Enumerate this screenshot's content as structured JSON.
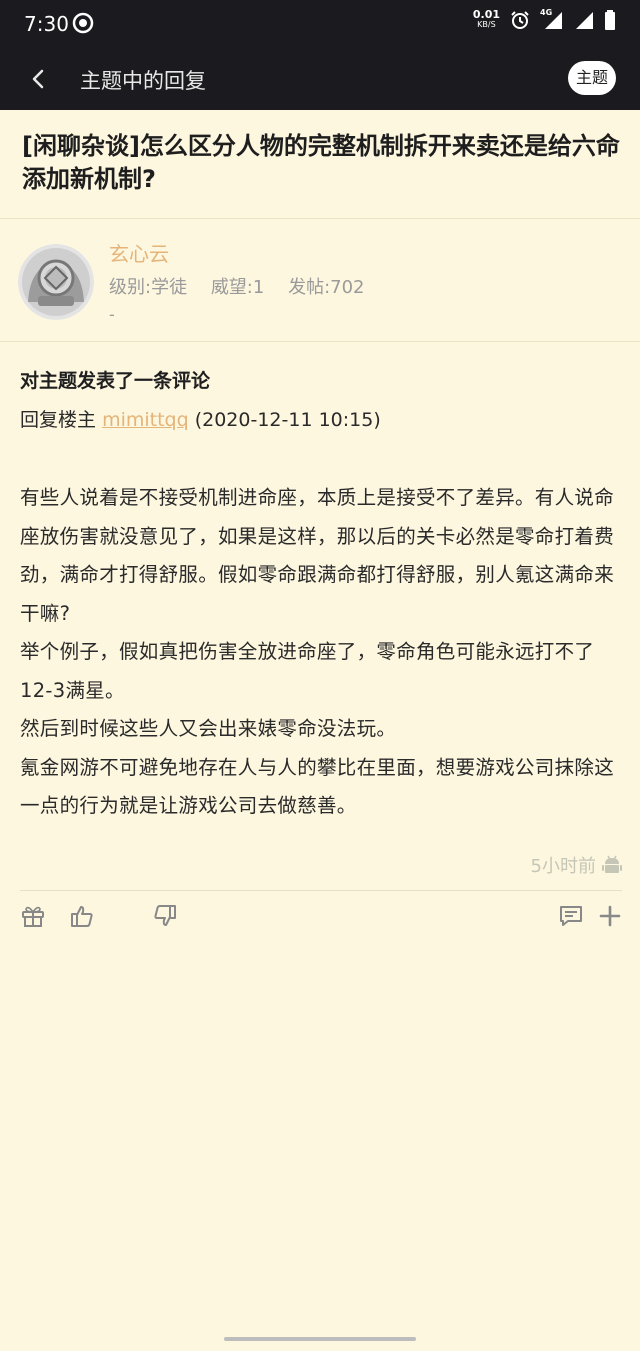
{
  "status_bar": {
    "time": "7:30",
    "net_speed_value": "0.01",
    "net_speed_unit": "KB/S",
    "network_type": "4G"
  },
  "app_bar": {
    "title": "主题中的回复",
    "topic_button_label": "主题"
  },
  "post": {
    "title": "[闲聊杂谈]怎么区分人物的完整机制拆开来卖还是给六命添加新机制?"
  },
  "author": {
    "name": "玄心云",
    "level": "级别:学徒",
    "prestige": "威望:1",
    "posts": "发帖:702",
    "signature": "-"
  },
  "comment": {
    "heading": "对主题发表了一条评论",
    "reply_prefix": "回复楼主",
    "reply_user": "mimittqq",
    "reply_time": "(2020-12-11 10:15)",
    "paragraphs": [
      "有些人说着是不接受机制进命座，本质上是接受不了差异。有人说命座放伤害就没意见了，如果是这样，那以后的关卡必然是零命打着费劲，满命才打得舒服。假如零命跟满命都打得舒服，别人氪这满命来干嘛?",
      "举个例子，假如真把伤害全放进命座了，零命角色可能永远打不了12-3满星。",
      "然后到时候这些人又会出来婊零命没法玩。",
      "氪金网游不可避免地存在人与人的攀比在里面，想要游戏公司抹除这一点的行为就是让游戏公司去做慈善。"
    ],
    "time_ago": "5小时前"
  },
  "colors": {
    "background": "#fdf7e0",
    "header": "#1b1b1f",
    "accent": "#e4b478"
  },
  "icons": [
    "back-icon",
    "gift-icon",
    "thumbs-up-icon",
    "thumbs-down-icon",
    "comment-icon",
    "plus-icon",
    "android-icon"
  ]
}
